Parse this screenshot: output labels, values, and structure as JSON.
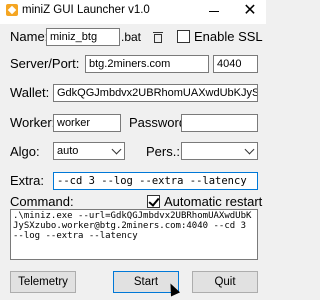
{
  "window": {
    "title": "miniZ GUI Launcher v1.0",
    "close_glyph": "✕"
  },
  "form": {
    "name_label": "Name:",
    "name_value": "miniz_btg",
    "bat_suffix": ".bat",
    "ssl_label": "Enable SSL",
    "ssl_checked": false,
    "server_label": "Server/Port:",
    "server_value": "btg.2miners.com",
    "port_value": "4040",
    "wallet_label": "Wallet:",
    "wallet_value": "GdkQGJmbdvx2UBRhomUAXwdUbKJySXzubo",
    "worker_label": "Worker:",
    "worker_value": "worker",
    "password_label": "Password:",
    "password_value": "",
    "algo_label": "Algo:",
    "algo_value": "auto",
    "pers_label": "Pers.:",
    "pers_value": "",
    "extra_label": "Extra:",
    "extra_value": "--cd 3 --log --extra --latency"
  },
  "command": {
    "label": "Command:",
    "auto_restart_label": "Automatic restart",
    "auto_restart_checked": true,
    "text": ".\\miniz.exe --url=GdkQGJmbdvx2UBRhomUAXwdUbKJySXzubo.worker@btg.2miners.com:4040 --cd 3 --log --extra --latency"
  },
  "buttons": {
    "telemetry": "Telemetry",
    "start": "Start",
    "quit": "Quit"
  },
  "icons": {
    "app": "miniz-app-icon",
    "trash": "trash-icon",
    "cursor": "mouse-cursor-icon"
  }
}
